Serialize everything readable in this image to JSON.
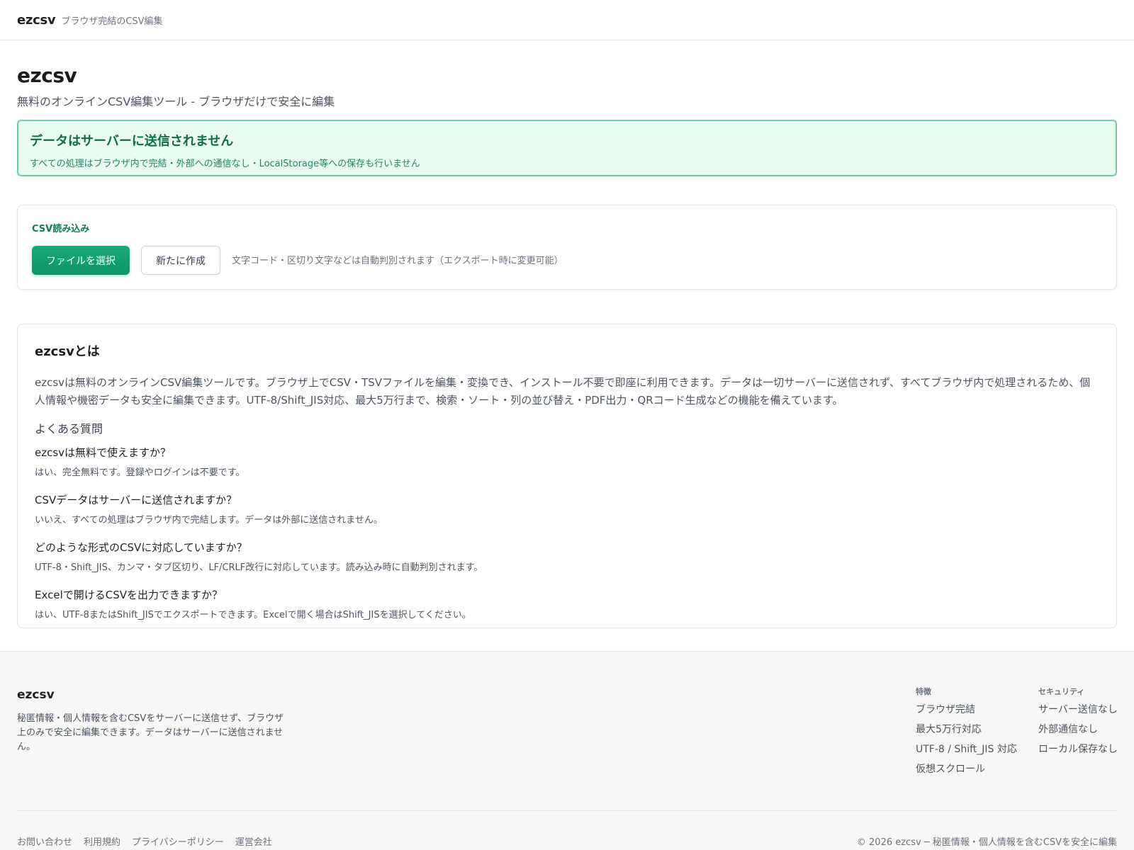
{
  "header": {
    "brand": "ezcsv",
    "tagline": "ブラウザ完結のCSV編集"
  },
  "hero": {
    "title": "ezcsv",
    "subtitle": "無料のオンラインCSV編集ツール - ブラウザだけで安全に編集"
  },
  "notice": {
    "title": "データはサーバーに送信されません",
    "description": "すべての処理はブラウザ内で完結・外部への通信なし・LocalStorage等への保存も行いません"
  },
  "upload": {
    "label": "CSV読み込み",
    "select_button": "ファイルを選択",
    "new_button": "新たに作成",
    "hint": "文字コード・区切り文字などは自動判別されます（エクスポート時に変更可能）"
  },
  "about": {
    "title": "ezcsvとは",
    "description": "ezcsvは無料のオンラインCSV編集ツールです。ブラウザ上でCSV・TSVファイルを編集・変換でき、インストール不要で即座に利用できます。データは一切サーバーに送信されず、すべてブラウザ内で処理されるため、個人情報や機密データも安全に編集できます。UTF-8/Shift_JIS対応、最大5万行まで、検索・ソート・列の並び替え・PDF出力・QRコード生成などの機能を備えています。",
    "faq_heading": "よくある質問",
    "faq": [
      {
        "q": "ezcsvは無料で使えますか？",
        "a": "はい、完全無料です。登録やログインは不要です。"
      },
      {
        "q": "CSVデータはサーバーに送信されますか？",
        "a": "いいえ、すべての処理はブラウザ内で完結します。データは外部に送信されません。"
      },
      {
        "q": "どのような形式のCSVに対応していますか？",
        "a": "UTF-8・Shift_JIS、カンマ・タブ区切り、LF/CRLF改行に対応しています。読み込み時に自動判別されます。"
      },
      {
        "q": "Excelで開けるCSVを出力できますか？",
        "a": "はい、UTF-8またはShift_JISでエクスポートできます。Excelで開く場合はShift_JISを選択してください。"
      }
    ]
  },
  "footer": {
    "brand": "ezcsv",
    "description": "秘匿情報・個人情報を含むCSVをサーバーに送信せず、ブラウザ上のみで安全に編集できます。データはサーバーに送信されません。",
    "features": {
      "heading": "特徴",
      "items": [
        "ブラウザ完結",
        "最大5万行対応",
        "UTF-8 / Shift_JIS 対応",
        "仮想スクロール"
      ]
    },
    "security": {
      "heading": "セキュリティ",
      "items": [
        "サーバー送信なし",
        "外部通信なし",
        "ローカル保存なし"
      ]
    },
    "links": [
      "お問い合わせ",
      "利用規約",
      "プライバシーポリシー",
      "運営会社"
    ],
    "copyright": "© 2026 ezcsv ─ 秘匿情報・個人情報を含むCSVを安全に編集"
  }
}
